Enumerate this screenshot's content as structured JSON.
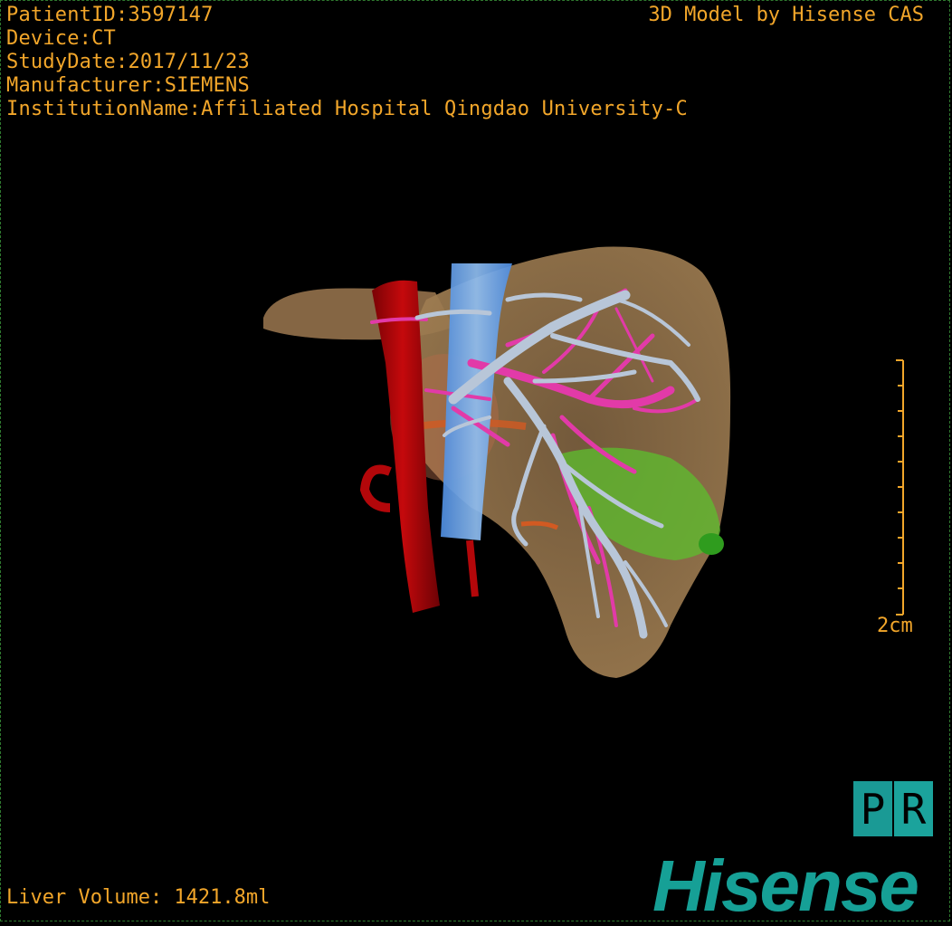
{
  "overlay": {
    "patient_id": "PatientID:3597147",
    "device": "Device:CT",
    "study_date": "StudyDate:2017/11/23",
    "manufacturer": "Manufacturer:SIEMENS",
    "institution": "InstitutionName:Affiliated Hospital Qingdao University-C",
    "model_credit": "3D Model by Hisense CAS",
    "liver_volume": "Liver Volume: 1421.8ml"
  },
  "scale_bar": {
    "label": "2cm"
  },
  "view_mode": {
    "p": "P",
    "r": "R"
  },
  "brand": {
    "logo_text": "Hisense"
  },
  "colors": {
    "text": "#f2a62a",
    "liver": "#8b6a45",
    "artery": "#b3070a",
    "ivc": "#6fa8e8",
    "portal_vein": "#b8c6d8",
    "hepatic_vein": "#e23aa8",
    "lesion": "#3fae2a",
    "brand": "#16a096"
  }
}
